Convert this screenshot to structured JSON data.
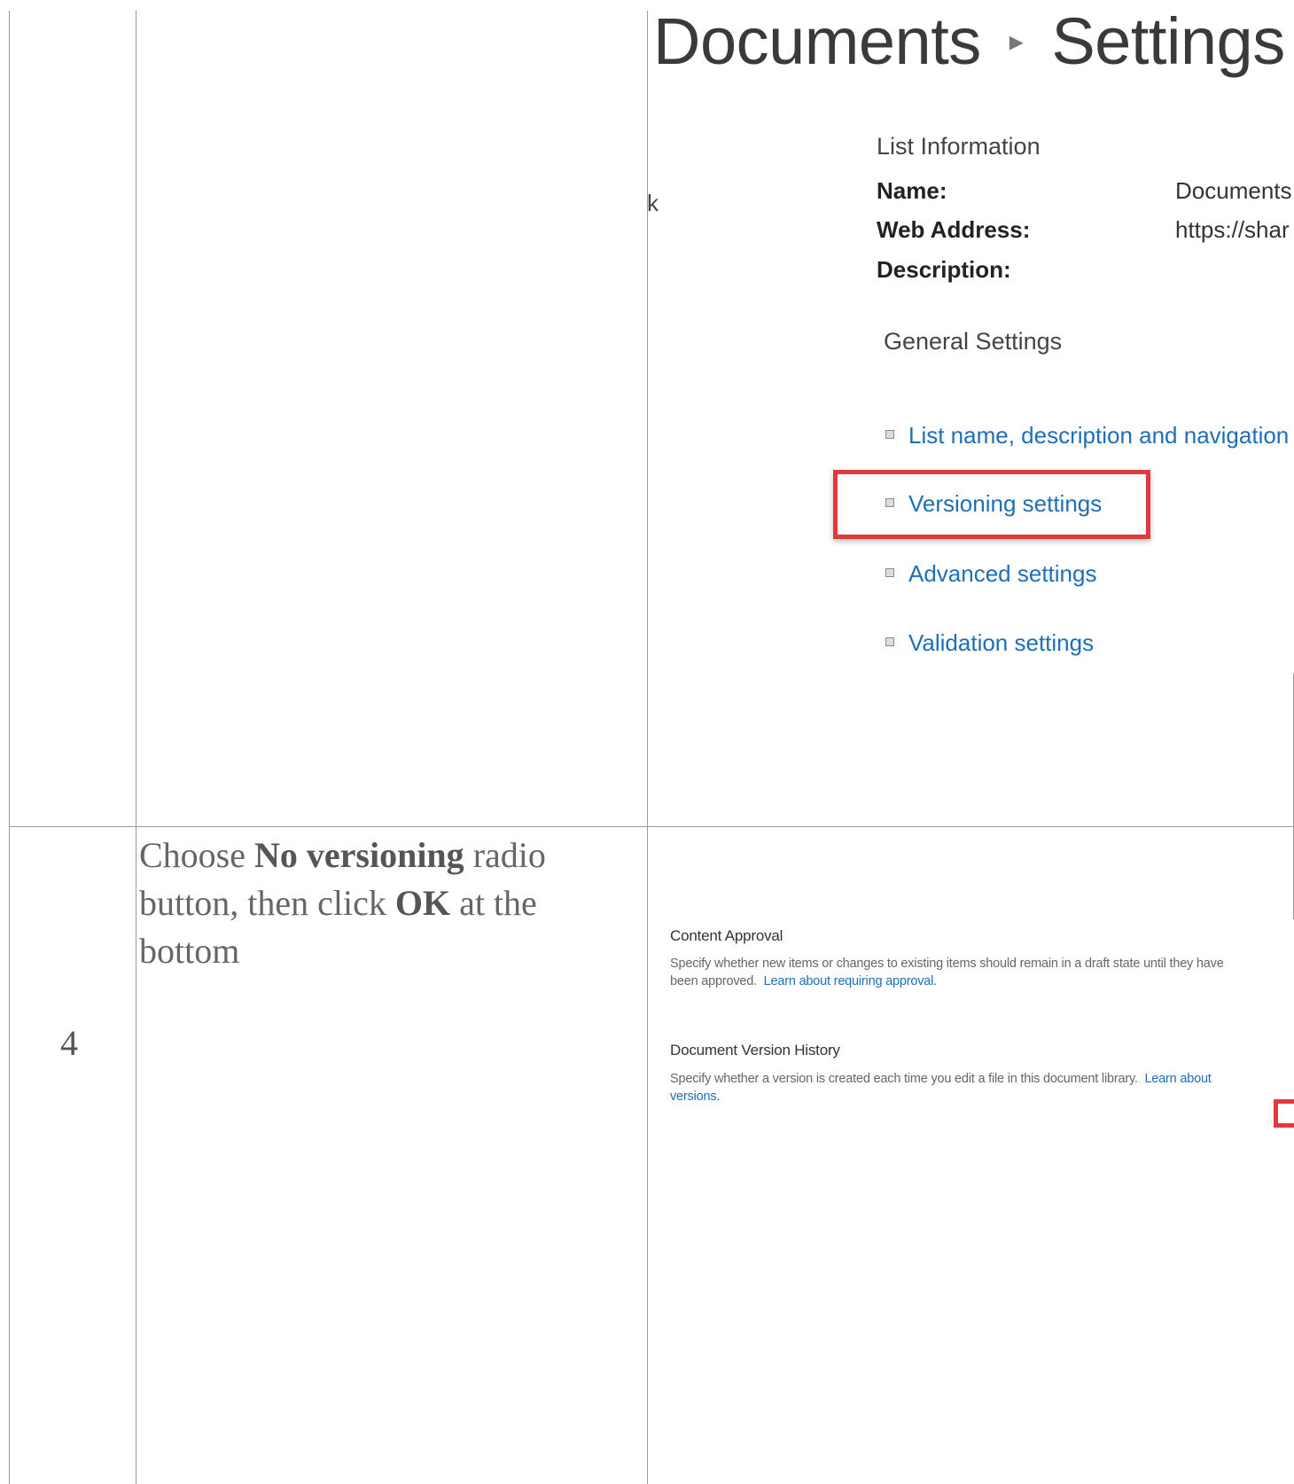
{
  "row3": {
    "screenshot": {
      "breadcrumb": {
        "list": "Documents",
        "separator": "▸",
        "page": "Settings"
      },
      "left_fragment": "k",
      "list_information": {
        "heading": "List Information",
        "name_label": "Name:",
        "name_value": "Documents",
        "web_address_label": "Web Address:",
        "web_address_value": "https://shar",
        "description_label": "Description:"
      },
      "general_settings": {
        "heading": "General Settings",
        "links": [
          "List name, description and navigation",
          "Versioning settings",
          "Advanced settings",
          "Validation settings"
        ]
      }
    }
  },
  "row4": {
    "step_number": "4",
    "instruction": {
      "part1": "Choose ",
      "bold1": "No versioning",
      "part2": " radio button, then click ",
      "bold2": "OK",
      "part3": " at the bottom"
    },
    "screenshot": {
      "content_approval": {
        "heading": "Content Approval",
        "description": "Specify whether new items or changes to existing items should remain in a draft state until they have been approved.",
        "link": "Learn about requiring approval."
      },
      "version_history": {
        "heading": "Document Version History",
        "description": "Specify whether a version is created each time you edit a file in this document library.",
        "link": "Learn about versions."
      }
    }
  },
  "colors": {
    "highlight": "#e03a3e",
    "link": "#1e6fb8",
    "border": "#9a9a9a"
  }
}
